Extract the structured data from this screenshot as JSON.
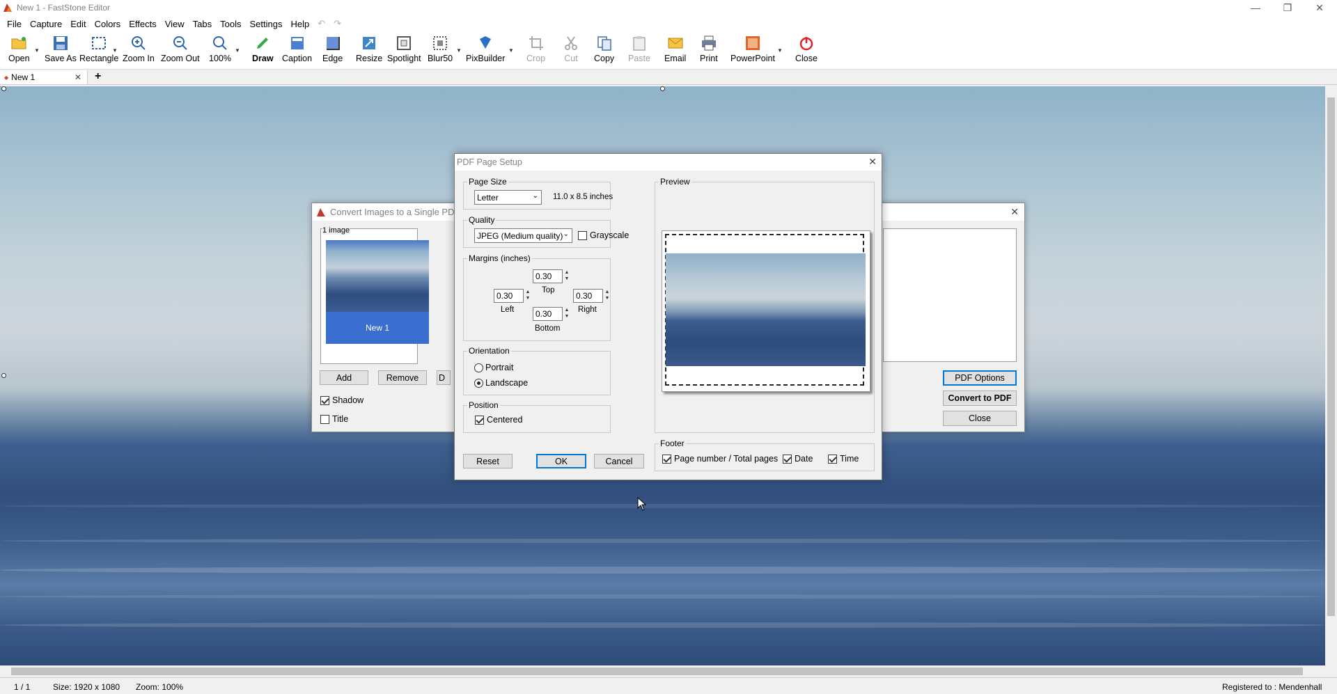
{
  "window": {
    "title": "New 1 - FastStone Editor"
  },
  "menu": [
    "File",
    "Capture",
    "Edit",
    "Colors",
    "Effects",
    "View",
    "Tabs",
    "Tools",
    "Settings",
    "Help"
  ],
  "toolbar": {
    "open": "Open",
    "save_as": "Save As",
    "rectangle": "Rectangle",
    "zoom_in": "Zoom In",
    "zoom_out": "Zoom Out",
    "zoom_level": "100%",
    "draw": "Draw",
    "caption": "Caption",
    "edge": "Edge",
    "resize": "Resize",
    "spotlight": "Spotlight",
    "blur": "Blur50",
    "pixbuilder": "PixBuilder",
    "crop": "Crop",
    "cut": "Cut",
    "copy": "Copy",
    "paste": "Paste",
    "email": "Email",
    "print": "Print",
    "powerpoint": "PowerPoint",
    "close": "Close"
  },
  "tabs": {
    "active": "New 1",
    "add": "+"
  },
  "status": {
    "page": "1 / 1",
    "size": "Size: 1920 x 1080",
    "zoom": "Zoom: 100%",
    "registered": "Registered to : Mendenhall"
  },
  "convert_dialog": {
    "title": "Convert Images to a Single PDF Fi",
    "image_count": "1 image",
    "thumb_label": "New 1",
    "add": "Add",
    "remove": "Remove",
    "partial_button": "D",
    "shadow": "Shadow",
    "title_opt": "Title",
    "pdf_options": "PDF Options",
    "convert": "Convert to PDF",
    "close": "Close"
  },
  "pdf_setup": {
    "title": "PDF Page Setup",
    "page_size_group": "Page Size",
    "page_size": "Letter",
    "page_dims": "11.0 x 8.5 inches",
    "quality_group": "Quality",
    "quality": "JPEG (Medium quality)",
    "grayscale": "Grayscale",
    "margins_group": "Margins (inches)",
    "margin_top": "0.30",
    "margin_left": "0.30",
    "margin_right": "0.30",
    "margin_bottom": "0.30",
    "top_label": "Top",
    "left_label": "Left",
    "right_label": "Right",
    "bottom_label": "Bottom",
    "orientation_group": "Orientation",
    "portrait": "Portrait",
    "landscape": "Landscape",
    "position_group": "Position",
    "centered": "Centered",
    "preview_group": "Preview",
    "footer_group": "Footer",
    "footer_page": "Page number / Total pages",
    "footer_date": "Date",
    "footer_time": "Time",
    "reset": "Reset",
    "ok": "OK",
    "cancel": "Cancel"
  }
}
